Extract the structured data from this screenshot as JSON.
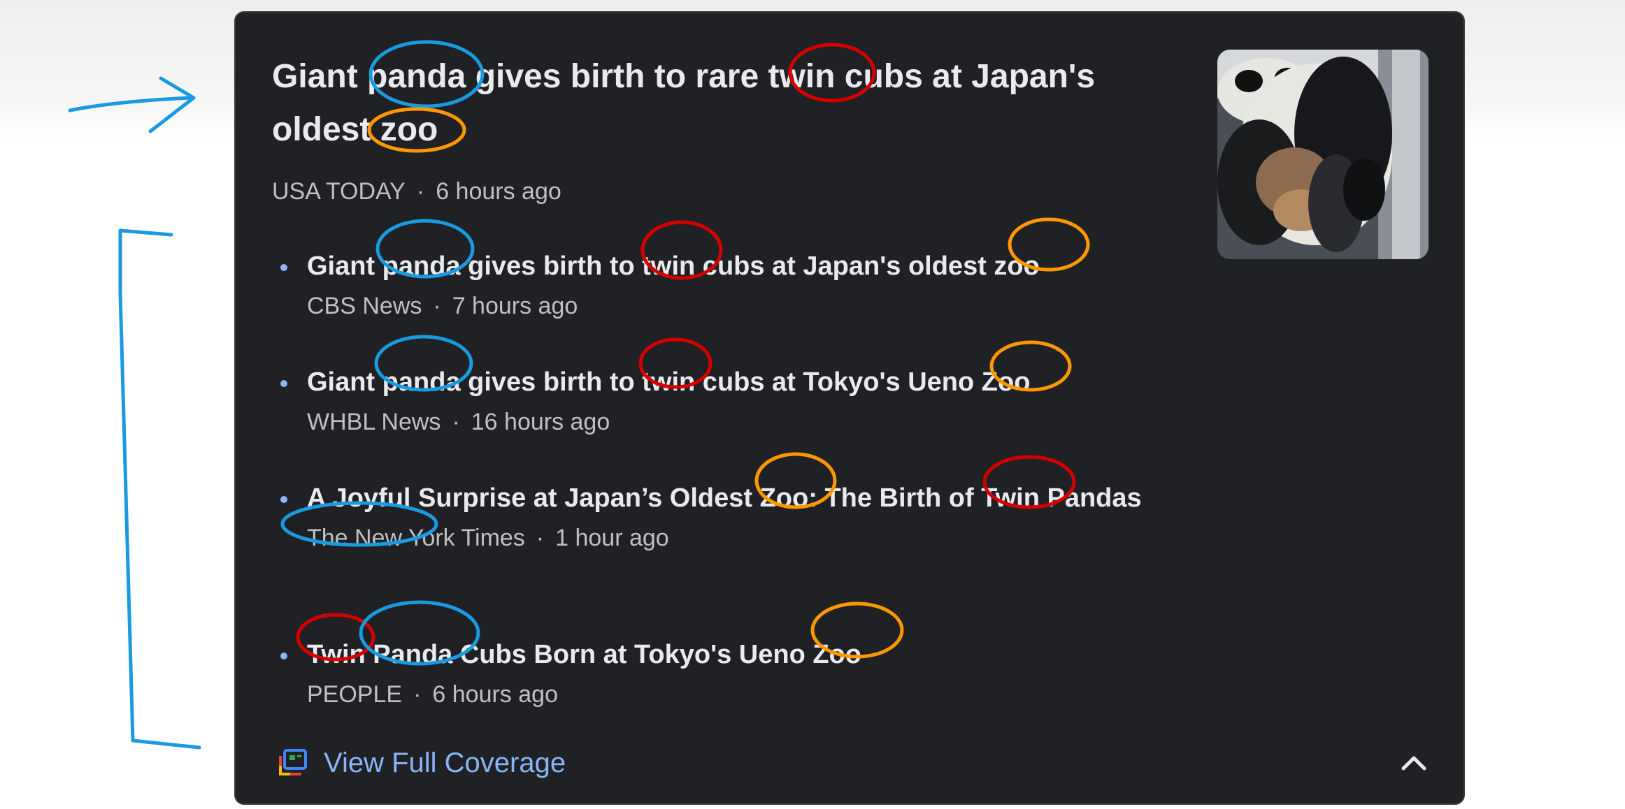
{
  "lead": {
    "title": "Giant panda gives birth to rare twin cubs at Japan's oldest zoo",
    "source": "USA TODAY",
    "time": "6 hours ago",
    "thumbnail_icon": "panda-photo"
  },
  "stories": [
    {
      "title": "Giant panda gives birth to twin cubs at Japan's oldest zoo",
      "source": "CBS News",
      "time": "7 hours ago"
    },
    {
      "title": "Giant panda gives birth to twin cubs at Tokyo's Ueno Zoo",
      "source": "WHBL News",
      "time": "16 hours ago"
    },
    {
      "title": "A Joyful Surprise at Japan’s Oldest Zoo: The Birth of Twin Pandas",
      "source": "The New York Times",
      "time": "1 hour ago"
    },
    {
      "title": "Twin Panda Cubs Born at Tokyo's Ueno Zoo",
      "source": "PEOPLE",
      "time": "6 hours ago"
    }
  ],
  "coverage": {
    "label": "View Full Coverage",
    "icon": "full-coverage-icon"
  },
  "collapse": {
    "icon": "chevron-up-icon"
  },
  "dot": "·",
  "colors": {
    "card_bg": "#202124",
    "title_text": "#e8eaed",
    "meta_text": "#bdc1c6",
    "link_blue": "#8ab4f8",
    "annotation_blue": "#1a9ae0",
    "annotation_red": "#d40000",
    "annotation_orange": "#ff9800"
  }
}
